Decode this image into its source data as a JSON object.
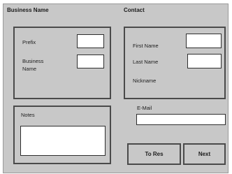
{
  "business_section": {
    "title": "Business Name",
    "prefix_label": "Prefix",
    "prefix_value": "",
    "business_name_label": "Business Name",
    "business_name_value": ""
  },
  "contact_section": {
    "title": "Contact",
    "first_name_label": "First Name",
    "first_name_value": "",
    "last_name_label": "Last Name",
    "last_name_value": "",
    "nickname_label": "Nickname"
  },
  "notes": {
    "label": "Notes",
    "value": ""
  },
  "email": {
    "label": "E-Mail",
    "value": ""
  },
  "buttons": {
    "to_res_label": "To Res",
    "next_label": "Next"
  }
}
